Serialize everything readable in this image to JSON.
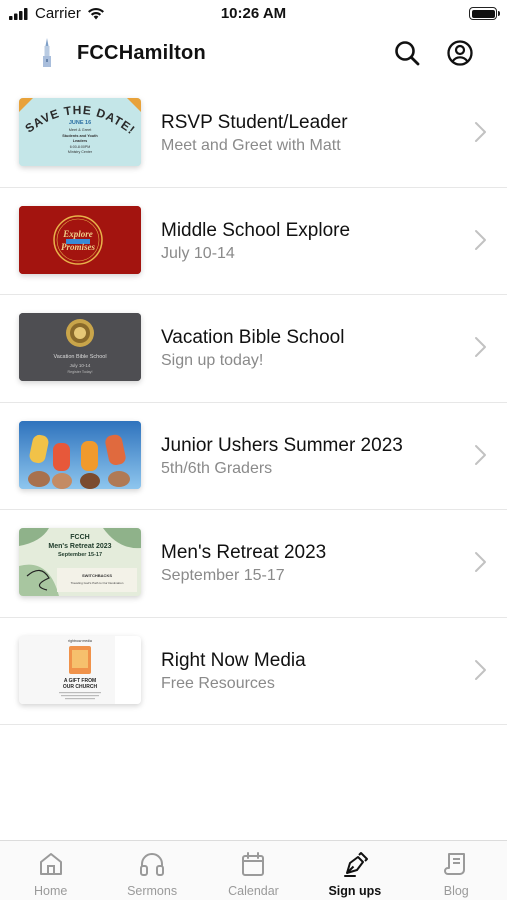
{
  "status_bar": {
    "carrier": "Carrier",
    "time": "10:26 AM"
  },
  "header": {
    "title": "FCCHamilton",
    "search_icon": "search-icon",
    "account_icon": "account-icon"
  },
  "items": [
    {
      "title": "RSVP Student/Leader",
      "subtitle": "Meet and Greet with Matt",
      "thumb": {
        "headline": "SAVE THE DATE!",
        "date": "JUNE 16",
        "line1": "Meet & Greet",
        "line2": "Students and Youth",
        "line3": "Leaders",
        "line4": "6:00-8:00PM",
        "line5": "Ministry Center"
      }
    },
    {
      "title": "Middle School Explore",
      "subtitle": "July 10-14",
      "thumb": {
        "line1": "Explore",
        "line2": "Promises"
      }
    },
    {
      "title": "Vacation Bible School",
      "subtitle": "Sign up today!",
      "thumb": {
        "line1": "Vacation Bible School",
        "line2": "July 10-14",
        "line3": "Register Today!"
      }
    },
    {
      "title": "Junior Ushers Summer 2023",
      "subtitle": "5th/6th Graders",
      "thumb": {}
    },
    {
      "title": "Men's Retreat 2023",
      "subtitle": "September 15-17",
      "thumb": {
        "line1": "FCCH",
        "line2": "Men's Retreat 2023",
        "line3": "September 15-17",
        "line4": "SWITCHBACKS",
        "line5": "Traveling God's Path to Our Destination"
      }
    },
    {
      "title": "Right Now Media",
      "subtitle": "Free Resources",
      "thumb": {
        "line1": "rightnow media",
        "line2": "A GIFT FROM",
        "line3": "OUR CHURCH"
      }
    }
  ],
  "tabs": [
    {
      "label": "Home",
      "icon": "home-icon",
      "active": false
    },
    {
      "label": "Sermons",
      "icon": "headphones-icon",
      "active": false
    },
    {
      "label": "Calendar",
      "icon": "calendar-icon",
      "active": false
    },
    {
      "label": "Sign ups",
      "icon": "pen-icon",
      "active": true
    },
    {
      "label": "Blog",
      "icon": "blog-icon",
      "active": false
    }
  ],
  "colors": {
    "accent": "#111111",
    "subtitle": "#8a8a8a",
    "tab_inactive": "#9a9a9a"
  }
}
